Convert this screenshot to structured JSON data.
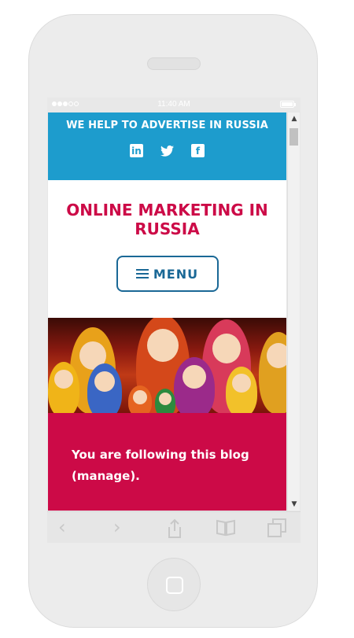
{
  "status_bar": {
    "time": "11:40 AM"
  },
  "site": {
    "tagline": "WE HELP TO ADVERTISE IN RUSSIA",
    "social": [
      {
        "name": "linkedin",
        "glyph": "in"
      },
      {
        "name": "twitter",
        "glyph": "🐦"
      },
      {
        "name": "facebook",
        "glyph": "f"
      }
    ],
    "title": "ONLINE MARKETING IN RUSSIA",
    "menu_label": "MENU",
    "follow_text": "You are following this blog (manage)."
  },
  "browser": {
    "back_glyph": "‹",
    "forward_glyph": "›",
    "scroll_up_glyph": "▲",
    "scroll_down_glyph": "▼"
  },
  "colors": {
    "topbar": "#1d9ccd",
    "title": "#cc0a47",
    "menu": "#1a6896",
    "follow_bg": "#cc0a47"
  }
}
